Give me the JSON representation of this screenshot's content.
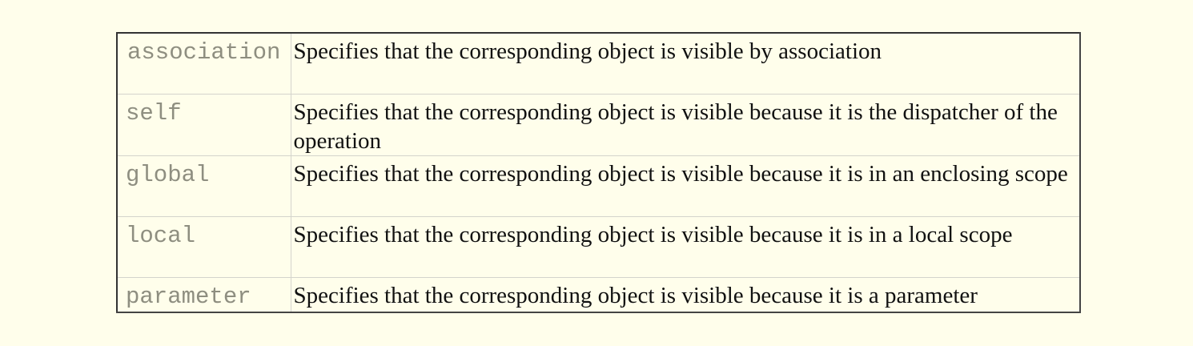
{
  "rows": [
    {
      "term": "association",
      "definition": "Specifies that the corresponding object is visible by association"
    },
    {
      "term": "self",
      "definition": "Specifies that the corresponding object is visible because it is the dispatcher of the operation"
    },
    {
      "term": "global",
      "definition": "Specifies that the corresponding object is visible because it is in an enclosing scope"
    },
    {
      "term": "local",
      "definition": "Specifies that the corresponding object is visible because it is in a local scope"
    },
    {
      "term": "parameter",
      "definition": "Specifies that the corresponding object is visible because it is a parameter"
    }
  ]
}
